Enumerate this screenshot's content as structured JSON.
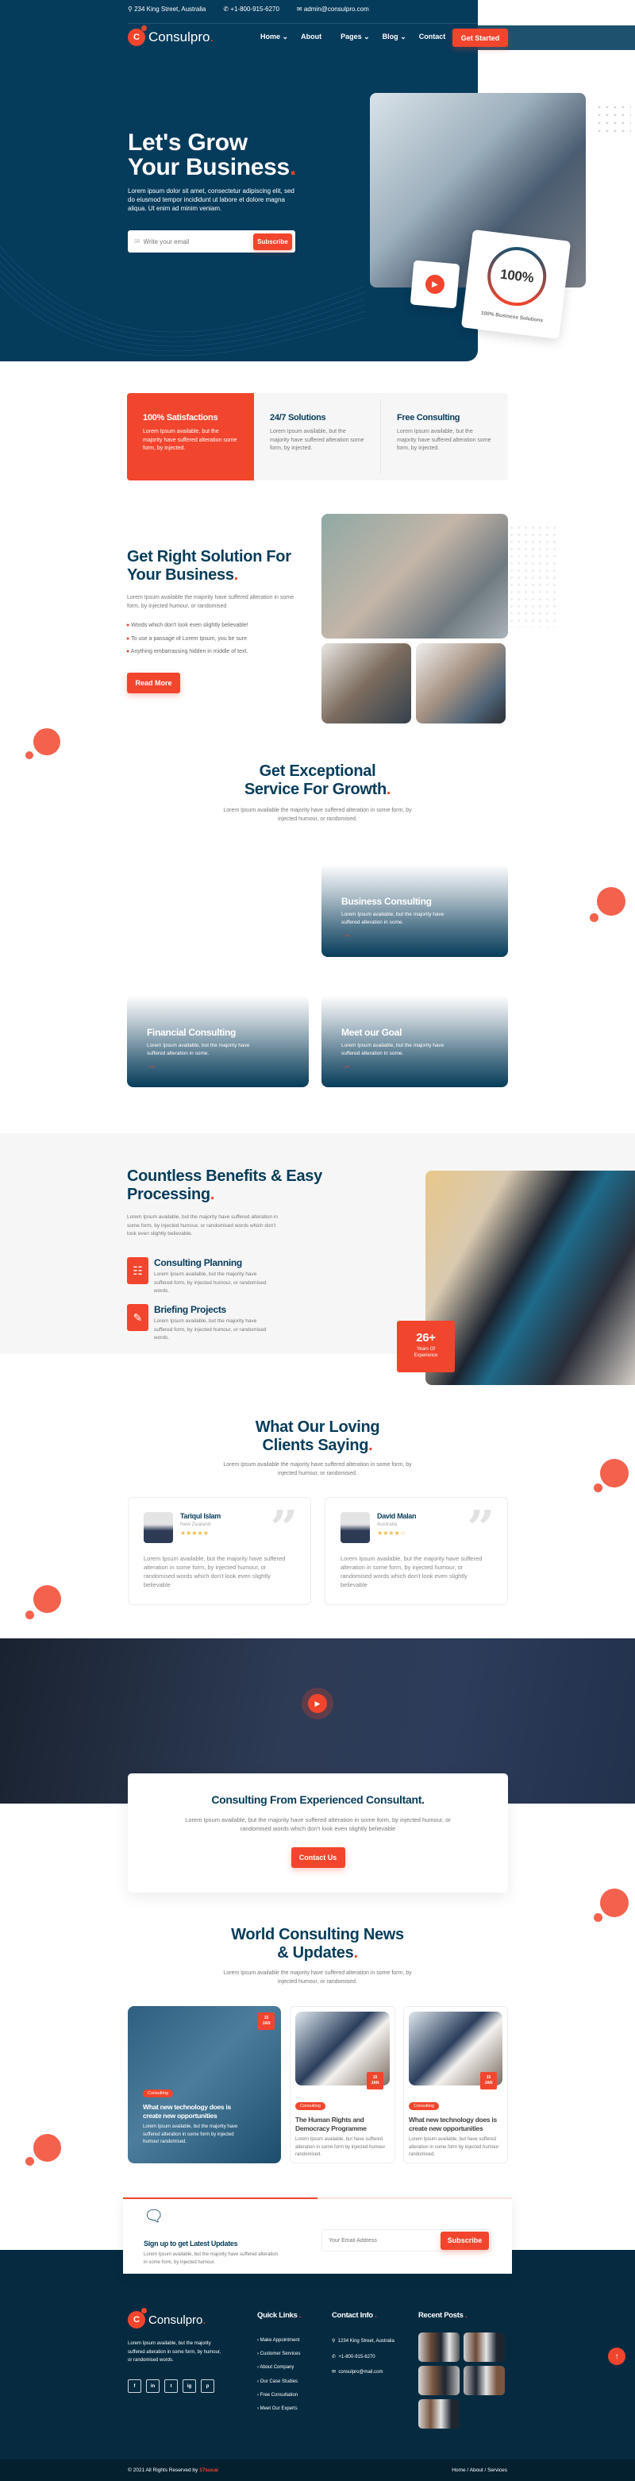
{
  "topbar": {
    "address": "234 King Street, Australia",
    "phone": "+1-800-915-6270",
    "email": "admin@consulpro.com"
  },
  "brand": {
    "name": "Consulpro",
    "logo_letter": "C"
  },
  "nav": {
    "items": [
      "Home",
      "About",
      "Pages",
      "Blog",
      "Contact"
    ],
    "dropdowns": [
      true,
      false,
      true,
      true,
      false
    ],
    "cta": "Get Started"
  },
  "hero": {
    "title_line1": "Let's Grow",
    "title_line2": "Your Business",
    "text": "Lorem ipsum dolor sit amet, consectetur adipiscing elit, sed do eiusmod tempor incididunt ut labore et dolore magna aliqua. Ut enim ad minim veniam.",
    "email_placeholder": "Write your email",
    "subscribe": "Subscribe",
    "progress_value": "100%",
    "progress_percent": 100,
    "progress_label": "100% Business Solutions"
  },
  "features": [
    {
      "title": "100% Satisfactions",
      "text": "Lorem Ipsum available, but the majority have suffered alteration some form, by injected."
    },
    {
      "title": "24/7 Solutions",
      "text": "Lorem Ipsum available, but the majority have suffered alteration some form, by injected."
    },
    {
      "title": "Free Consulting",
      "text": "Lorem Ipsum available, but the majority have suffered alteration some form, by injected."
    }
  ],
  "solution": {
    "title_line1": "Get Right Solution For",
    "title_line2": "Your Business",
    "text": "Lorem Ipsum available the majority have suffered alteration in some form, by injected humour, or randomised",
    "checks": [
      "Words which don't look even slightly believable!",
      "To use a passage of Lorem Ipsum, you be sure",
      "Anything embarrassing hidden in middle of text."
    ],
    "button": "Read More"
  },
  "services": {
    "title_line1": "Get Exceptional",
    "title_line2": "Service For Growth",
    "text": "Lorem Ipsum available the majority have suffered alteration in some form, by injected humour, or randomised.",
    "cards": [
      {
        "title": "Business Consulting",
        "text": "Lorem Ipsum available, but the majority have suffered alteration in some."
      },
      {
        "title": "Financial Consulting",
        "text": "Lorem Ipsum available, but the majority have suffered alteration in some."
      },
      {
        "title": "Meet our Goal",
        "text": "Lorem Ipsum available, but the majority have suffered alteration in some."
      }
    ]
  },
  "benefits": {
    "title_line1": "Countless Benefits & Easy",
    "title_line2": "Processing",
    "text": "Lorem Ipsum available, but the majority have suffered alteration in some form, by injected humour, or randomised words which don't look even slightly believable.",
    "items": [
      {
        "title": "Consulting Planning",
        "text": "Lorem Ipsum available, but the majority have suffered form, by injected humour, or randomised words."
      },
      {
        "title": "Briefing Projects",
        "text": "Lorem Ipsum available, but the majority have suffered form, by injected humour, or randomised words."
      }
    ],
    "badge_value": "26+",
    "badge_label": "Years Of Experience"
  },
  "testimonials": {
    "title_line1": "What Our Loving",
    "title_line2": "Clients Saying",
    "text": "Lorem Ipsum available the majority have suffered alteration in some form, by injected humour, or randomised.",
    "items": [
      {
        "name": "Tariqul Islam",
        "location": "New Zealand",
        "rating": 5,
        "text": "Lorem Ipsum available, but the majority have suffered alteration in some form, by injected humour, or randomised words which don't look even slightly believable"
      },
      {
        "name": "David Malan",
        "location": "Australia",
        "rating": 4,
        "text": "Lorem Ipsum available, but the majority have suffered alteration in some form, by injected humour, or randomised words which don't look even slightly believable"
      }
    ]
  },
  "cta": {
    "title": "Consulting From Experienced Consultant.",
    "text": "Lorem Ipsum available, but the majority have suffered alteration in some form, by injected humour, or randomised words which don't look even slightly believable",
    "button": "Contact Us"
  },
  "news": {
    "title_line1": "World Consulting News",
    "title_line2": "& Updates",
    "text": "Lorem Ipsum available the majority have suffered alteration in some form, by injected humour, or randomised.",
    "posts": [
      {
        "day": "15",
        "month": "JAN",
        "tag": "Consulting",
        "title": "What new technology does is create new opportunities",
        "text": "Lorem Ipsum available, but the majority have suffered alteration in some form by injected humour randomised."
      },
      {
        "day": "15",
        "month": "JAN",
        "tag": "Consulting",
        "title": "The Human Rights and Democracy Programme",
        "text": "Lorem Ipsum available, but have suffered alteration in some form by injected humour randomised."
      },
      {
        "day": "15",
        "month": "JAN",
        "tag": "Consulting",
        "title": "What new technology does is create new opportunities",
        "text": "Lorem Ipsum available, but have suffered alteration in some form by injected humour randomised."
      }
    ]
  },
  "newsletter": {
    "title": "Sign up to get Latest Updates",
    "text": "Lorem Ipsum available, but the majority have suffered alteration in some form, by injected humour.",
    "placeholder": "Your Email Address",
    "button": "Subscribe"
  },
  "footer": {
    "about": "Lorem Ipsum available, but the majority suffered alteration in some form, by humour, or randomised words.",
    "social": [
      "f",
      "in",
      "t",
      "ig",
      "p"
    ],
    "quick_title": "Quick Links",
    "quick_links": [
      "Make Appointment",
      "Customer Services",
      "About Company",
      "Our Case Studies",
      "Free Consultation",
      "Meet Our Experts"
    ],
    "contact_title": "Contact Info",
    "address": "1234 King Street, Australia",
    "phone": "+1-800-915-6270",
    "email": "consulpro@mail.com",
    "posts_title": "Recent Posts",
    "copyright": "© 2021 All Rights Reserved by",
    "author": "17sucai",
    "bottom_links": [
      "Home",
      "About",
      "Services"
    ]
  },
  "colors": {
    "primary": "#063c5a",
    "accent": "#f2452d",
    "footer": "#062b40"
  }
}
